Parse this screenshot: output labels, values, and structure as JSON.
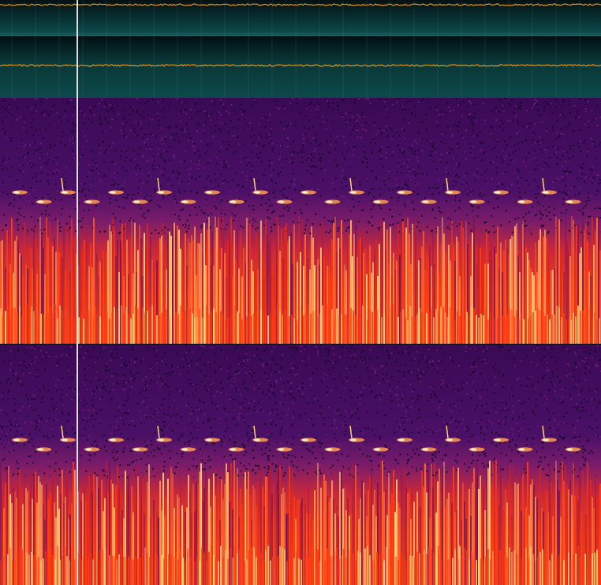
{
  "view": "audio-spectrogram-editor",
  "channels": [
    "left",
    "right"
  ],
  "playhead": {
    "position_fraction": 0.128
  },
  "colors": {
    "waveform_bg_dark": "#021012",
    "waveform_bg_mid": "#0c4646",
    "waveform_line": "#e6951a",
    "spec_low": "#1a0527",
    "spec_mid": "#5a1470",
    "spec_hot": "#ff3a10",
    "spec_peak": "#ffd27a"
  },
  "spectrogram": {
    "colormap": "inferno-like",
    "chirp_count": 24
  }
}
